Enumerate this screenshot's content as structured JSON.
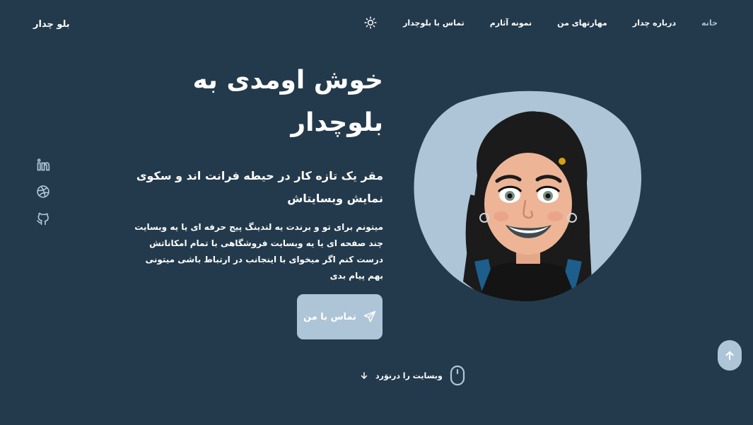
{
  "header": {
    "logo": "بلو چدار",
    "theme_icon": "sun-icon",
    "nav": [
      {
        "label": "خانه",
        "active": true
      },
      {
        "label": "درباره چدار",
        "active": false
      },
      {
        "label": "مهارتهای من",
        "active": false
      },
      {
        "label": "نمونه آثارم",
        "active": false
      },
      {
        "label": "تماس با بلوچدار",
        "active": false
      }
    ]
  },
  "socials": [
    {
      "icon": "linkedin-icon"
    },
    {
      "icon": "dribbble-icon"
    },
    {
      "icon": "github-icon"
    }
  ],
  "hero": {
    "title": "خوش اومدی به بلوچدار",
    "subtitle": "مقر یک تازه کار در حیطه فرانت اند و سکوی نمایش وبسایتاش",
    "description": "میتونم برای تو و برندت یه لندینگ پیج حرفه ای یا یه وبسایت چند صفحه ای یا یه وبسایت فروشگاهی با تمام امکاناتش درست کنم اگر میخوای با اینجانب در ارتباط باشی میتونی بهم پیام بدی",
    "contact_button": "تماس با من",
    "contact_icon": "send-icon",
    "avatar": "avatar-illustration"
  },
  "scroll": {
    "label": "وبسایت را درنوَرد",
    "mouse_icon": "mouse-icon",
    "arrow_icon": "arrow-down-icon"
  },
  "scroll_top_icon": "arrow-up-icon",
  "colors": {
    "background": "#233a4c",
    "accent": "#adc5d6",
    "active_nav": "#a7c0d1",
    "text": "#ffffff"
  }
}
